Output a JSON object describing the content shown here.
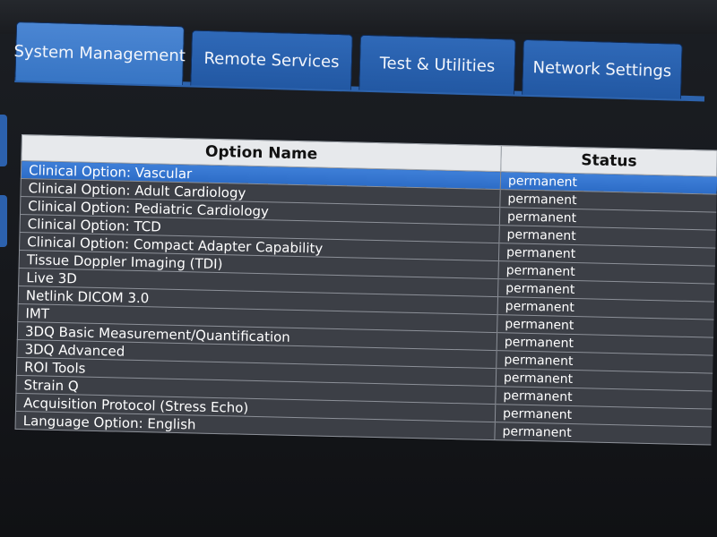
{
  "tabs": [
    {
      "label": "System Management",
      "active": true
    },
    {
      "label": "Remote Services",
      "active": false
    },
    {
      "label": "Test & Utilities",
      "active": false
    },
    {
      "label": "Network Settings",
      "active": false
    }
  ],
  "table": {
    "headers": {
      "name": "Option Name",
      "status": "Status"
    },
    "rows": [
      {
        "name": "Clinical Option: Vascular",
        "status": "permanent",
        "selected": true
      },
      {
        "name": "Clinical Option: Adult Cardiology",
        "status": "permanent"
      },
      {
        "name": "Clinical Option: Pediatric Cardiology",
        "status": "permanent"
      },
      {
        "name": "Clinical Option: TCD",
        "status": "permanent"
      },
      {
        "name": "Clinical Option: Compact Adapter Capability",
        "status": "permanent"
      },
      {
        "name": "Tissue Doppler Imaging (TDI)",
        "status": "permanent"
      },
      {
        "name": "Live 3D",
        "status": "permanent"
      },
      {
        "name": "Netlink DICOM 3.0",
        "status": "permanent"
      },
      {
        "name": "IMT",
        "status": "permanent"
      },
      {
        "name": "3DQ Basic Measurement/Quantification",
        "status": "permanent"
      },
      {
        "name": "3DQ Advanced",
        "status": "permanent"
      },
      {
        "name": "ROI Tools",
        "status": "permanent"
      },
      {
        "name": "Strain Q",
        "status": "permanent"
      },
      {
        "name": "Acquisition Protocol (Stress Echo)",
        "status": "permanent"
      },
      {
        "name": "Language Option: English",
        "status": "permanent"
      }
    ]
  },
  "colors": {
    "tab_active": "#3775c4",
    "tab_inactive": "#2258a3",
    "selected_row": "#2c6cc6",
    "row_background": "#3c3f46",
    "header_background": "#e7e9ec"
  }
}
